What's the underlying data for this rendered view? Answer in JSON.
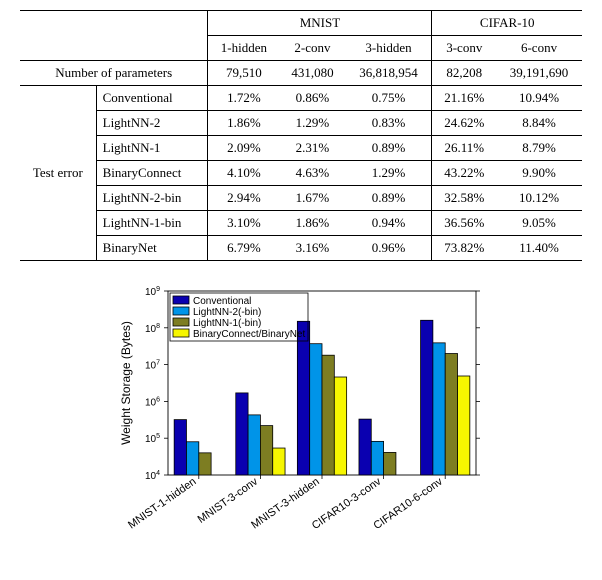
{
  "table": {
    "cols_top": [
      "MNIST",
      "CIFAR-10"
    ],
    "cols_sub": [
      "1-hidden",
      "2-conv",
      "3-hidden",
      "3-conv",
      "6-conv"
    ],
    "param_label": "Number of parameters",
    "params": [
      "79,510",
      "431,080",
      "36,818,954",
      "82,208",
      "39,191,690"
    ],
    "group_label": "Test error",
    "rows": [
      {
        "name": "Conventional",
        "vals": [
          "1.72%",
          "0.86%",
          "0.75%",
          "21.16%",
          "10.94%"
        ]
      },
      {
        "name": "LightNN-2",
        "vals": [
          "1.86%",
          "1.29%",
          "0.83%",
          "24.62%",
          "8.84%"
        ]
      },
      {
        "name": "LightNN-1",
        "vals": [
          "2.09%",
          "2.31%",
          "0.89%",
          "26.11%",
          "8.79%"
        ]
      },
      {
        "name": "BinaryConnect",
        "vals": [
          "4.10%",
          "4.63%",
          "1.29%",
          "43.22%",
          "9.90%"
        ]
      },
      {
        "name": "LightNN-2-bin",
        "vals": [
          "2.94%",
          "1.67%",
          "0.89%",
          "32.58%",
          "10.12%"
        ]
      },
      {
        "name": "LightNN-1-bin",
        "vals": [
          "3.10%",
          "1.86%",
          "0.94%",
          "36.56%",
          "9.05%"
        ]
      },
      {
        "name": "BinaryNet",
        "vals": [
          "6.79%",
          "3.16%",
          "0.96%",
          "73.82%",
          "11.40%"
        ]
      }
    ]
  },
  "chart_data": {
    "type": "bar",
    "title": "",
    "xlabel": "",
    "ylabel": "Weight Storage (Bytes)",
    "ylim": [
      10000.0,
      1000000000.0
    ],
    "yticks": [
      10000.0,
      100000.0,
      1000000.0,
      10000000.0,
      100000000.0,
      1000000000.0
    ],
    "ytick_labels": [
      "10^4",
      "10^5",
      "10^6",
      "10^7",
      "10^8",
      "10^9"
    ],
    "categories": [
      "MNIST-1-hidden",
      "MNIST-3-conv",
      "MNIST-3-hidden",
      "CIFAR10-3-conv",
      "CIFAR10-6-conv"
    ],
    "series": [
      {
        "name": "Conventional",
        "color": "#0a00b0",
        "values": [
          320000.0,
          1700000.0,
          150000000.0,
          330000.0,
          160000000.0
        ]
      },
      {
        "name": "LightNN-2(-bin)",
        "color": "#0094e8",
        "values": [
          80000.0,
          430000.0,
          37000000.0,
          82000.0,
          39000000.0
        ]
      },
      {
        "name": "LightNN-1(-bin)",
        "color": "#7d7d22",
        "values": [
          40000.0,
          220000.0,
          18000000.0,
          41000.0,
          20000000.0
        ]
      },
      {
        "name": "BinaryConnect/BinaryNet",
        "color": "#f6f600",
        "values": [
          10000.0,
          54000.0,
          4600000.0,
          10000.0,
          4900000.0
        ]
      }
    ],
    "legend_position": "top-left"
  }
}
